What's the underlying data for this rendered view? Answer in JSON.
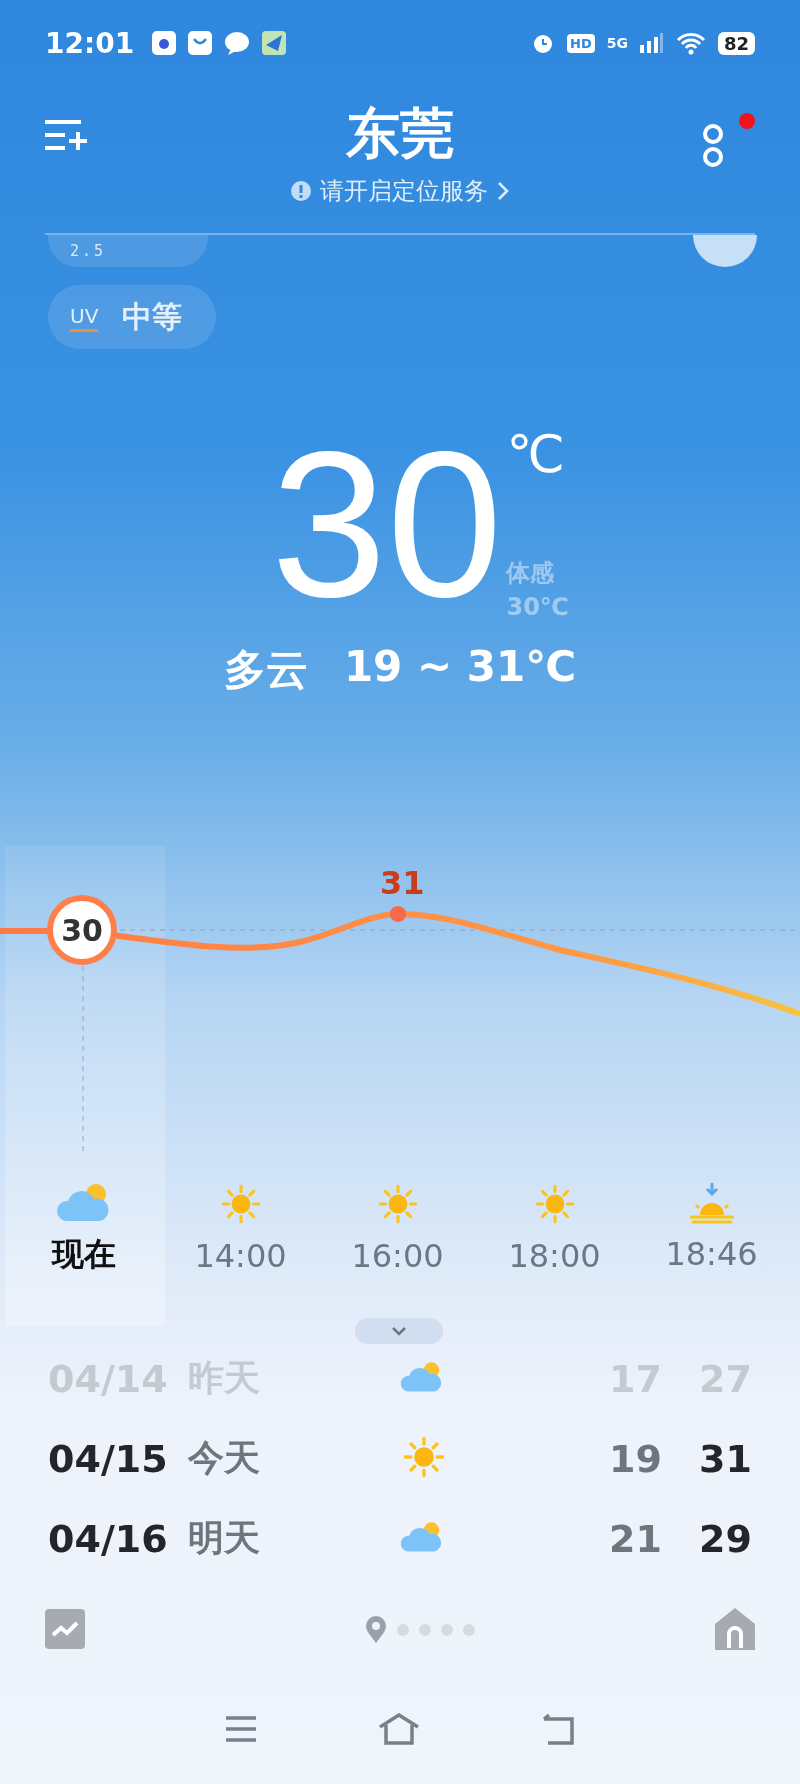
{
  "status_bar": {
    "time": "12:01",
    "hd": "HD",
    "network": "5G",
    "battery": "82"
  },
  "header": {
    "city": "东莞",
    "notice": "请开启定位服务",
    "has_notification": true
  },
  "chips": [
    {
      "kind": "pm",
      "label": "2.5"
    },
    {
      "kind": "uv",
      "label": "UV",
      "value": "中等"
    }
  ],
  "current": {
    "temp": "30",
    "unit": "℃",
    "feels_label": "体感",
    "feels_value": "30℃",
    "condition": "多云",
    "range": "19 ~ 31℃"
  },
  "hourly": {
    "now_marker": "30",
    "peak_label": "31",
    "items": [
      {
        "time": "现在",
        "kind": "cloudy",
        "selected": true
      },
      {
        "time": "14:00",
        "kind": "sunny",
        "selected": false
      },
      {
        "time": "16:00",
        "kind": "sunny",
        "selected": false
      },
      {
        "time": "18:00",
        "kind": "sunny",
        "selected": false
      },
      {
        "time": "18:46",
        "kind": "sunset",
        "selected": false
      }
    ]
  },
  "daily": [
    {
      "date": "04/14",
      "day": "昨天",
      "kind": "cloudy",
      "low": "17",
      "high": "27",
      "past": true
    },
    {
      "date": "04/15",
      "day": "今天",
      "kind": "sunny",
      "low": "19",
      "high": "31",
      "past": false
    },
    {
      "date": "04/16",
      "day": "明天",
      "kind": "cloudy",
      "low": "21",
      "high": "29",
      "past": false
    }
  ],
  "pager": [
    {
      "kind": "location",
      "selected": true
    },
    {
      "kind": "dot",
      "selected": false
    },
    {
      "kind": "dot",
      "selected": false
    },
    {
      "kind": "dot",
      "selected": false
    },
    {
      "kind": "dot",
      "selected": false
    }
  ]
}
